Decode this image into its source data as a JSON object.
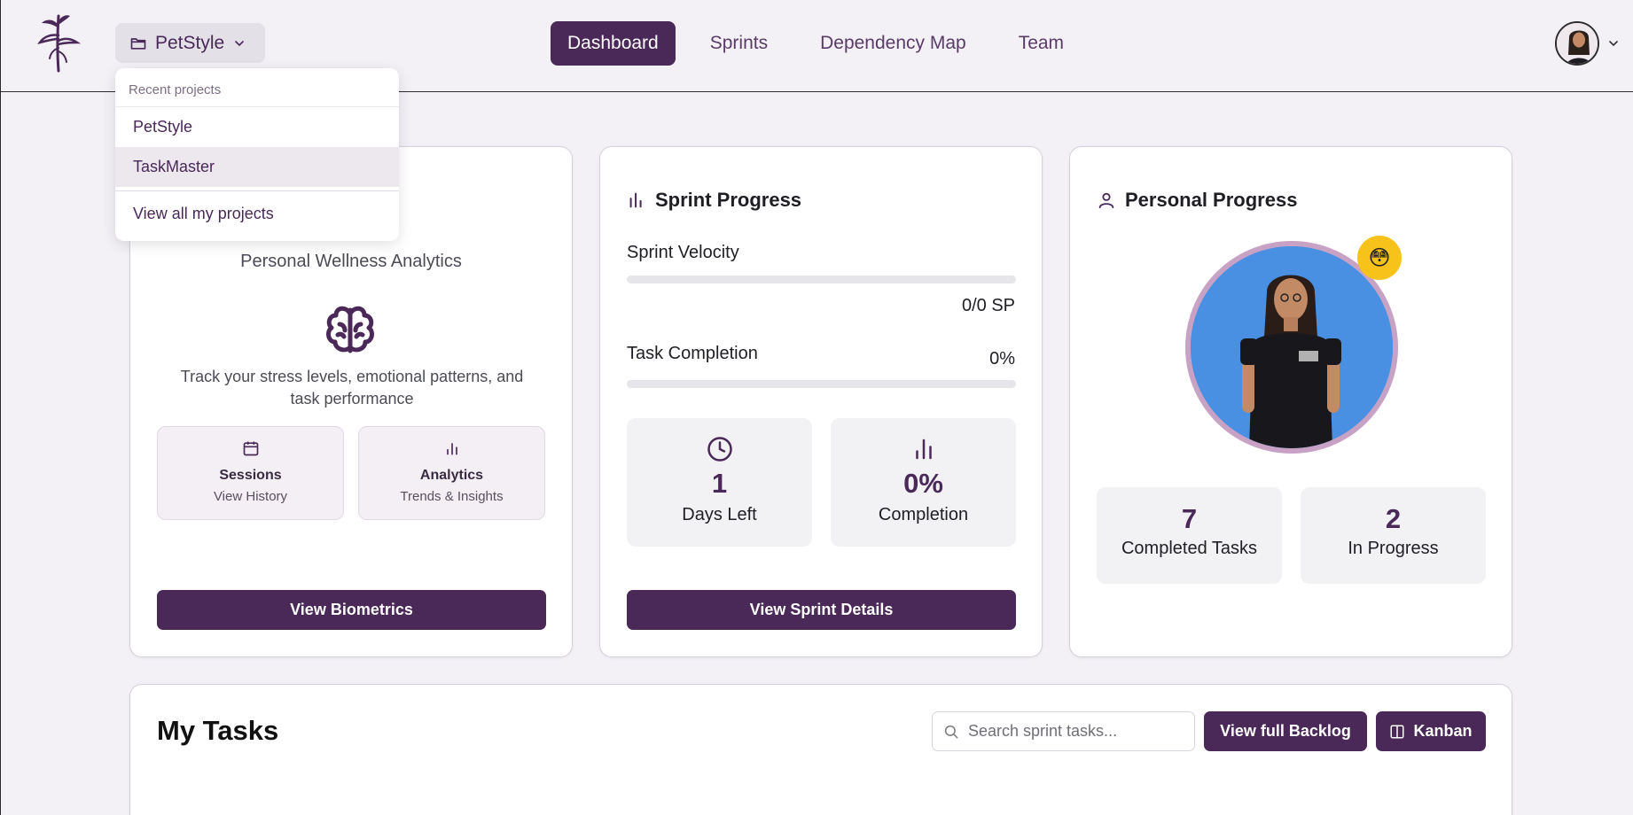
{
  "header": {
    "project_selector": {
      "label": "PetStyle"
    },
    "nav": [
      {
        "label": "Dashboard",
        "active": true
      },
      {
        "label": "Sprints",
        "active": false
      },
      {
        "label": "Dependency Map",
        "active": false
      },
      {
        "label": "Team",
        "active": false
      }
    ]
  },
  "project_dropdown": {
    "heading": "Recent projects",
    "items": [
      {
        "label": "PetStyle"
      },
      {
        "label": "TaskMaster"
      }
    ],
    "view_all": "View all my projects"
  },
  "wellness_card": {
    "subtitle": "Personal Wellness Analytics",
    "description": "Track your stress levels, emotional patterns, and task performance",
    "tiles": [
      {
        "title": "Sessions",
        "subtitle": "View History",
        "icon": "calendar-icon"
      },
      {
        "title": "Analytics",
        "subtitle": "Trends & Insights",
        "icon": "bar-chart-icon"
      }
    ],
    "button": "View Biometrics"
  },
  "sprint_card": {
    "title": "Sprint Progress",
    "velocity_label": "Sprint Velocity",
    "velocity_value": "0/0 SP",
    "velocity_fraction": 0,
    "completion_label": "Task Completion",
    "completion_value": "0%",
    "completion_fraction": 0,
    "stats": [
      {
        "value": "1",
        "label": "Days Left",
        "icon": "clock-icon"
      },
      {
        "value": "0%",
        "label": "Completion",
        "icon": "bar-chart-icon"
      }
    ],
    "button": "View Sprint Details"
  },
  "personal_card": {
    "title": "Personal Progress",
    "mood_emoji": "😳",
    "stats": [
      {
        "value": "7",
        "label": "Completed Tasks"
      },
      {
        "value": "2",
        "label": "In Progress"
      }
    ]
  },
  "tasks": {
    "title": "My Tasks",
    "search_placeholder": "Search sprint tasks...",
    "backlog_button": "View full Backlog",
    "kanban_button": "Kanban"
  },
  "colors": {
    "brand": "#4a2858",
    "background": "#f3f1f6",
    "avatar_bg": "#4a90e2",
    "badge": "#f7c21a"
  }
}
